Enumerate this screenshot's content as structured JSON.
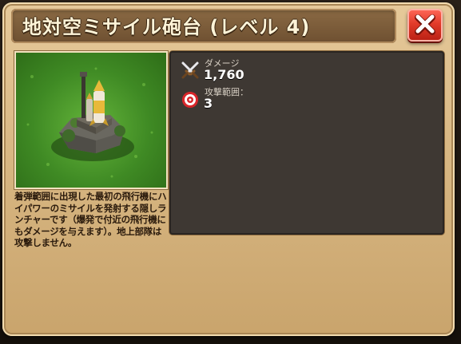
{
  "header": {
    "title": "地対空ミサイル砲台 (レベル 4)",
    "close_icon": "close-x-icon",
    "close_color": "#e23b2a"
  },
  "preview": {
    "subject": "missile-launcher-building"
  },
  "description": {
    "text": "着弾範囲に出現した最初の飛行機にハイパワーのミサイルを発射する隠しランチャーです（爆発で付近の飛行機にもダメージを与えます）。地上部隊は攻撃しません。"
  },
  "stats": [
    {
      "icon": "crossed-swords-icon",
      "label": "ダメージ",
      "value": "1,760"
    },
    {
      "icon": "target-icon",
      "label": "攻撃範囲：",
      "value": "3"
    }
  ],
  "colors": {
    "panel": "#d8b783",
    "title_bar": "#6e5031",
    "stats_panel": "#3e3833"
  }
}
